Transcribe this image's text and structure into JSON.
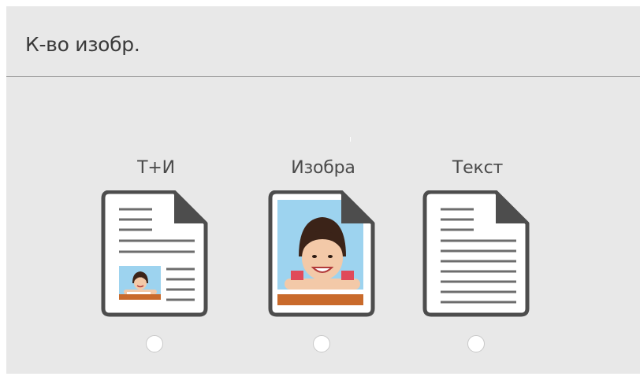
{
  "header": {
    "title": "К-во изобр."
  },
  "options": [
    {
      "label": "Т+И",
      "icon": "text-and-image-document-icon",
      "selected": false
    },
    {
      "label": "Изобра",
      "icon": "image-document-icon",
      "selected": false
    },
    {
      "label": "Текст",
      "icon": "text-document-icon",
      "selected": false
    }
  ],
  "colors": {
    "panel_background": "#e8e8e8",
    "divider": "#8f8f8f",
    "document_outline": "#4d4d4d",
    "photo_sky": "#9dd3ef",
    "radio_fill": "#ffffff"
  }
}
